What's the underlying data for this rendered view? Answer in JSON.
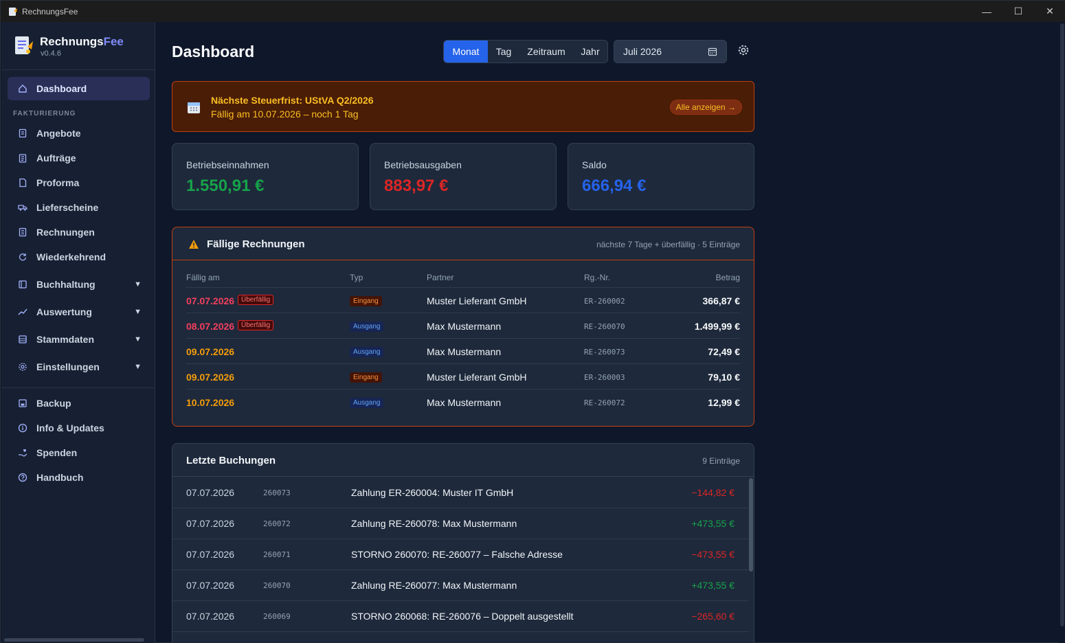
{
  "window": {
    "title": "RechnungsFee"
  },
  "brand": {
    "name_part1": "Rechnungs",
    "name_part2": "Fee",
    "version": "v0.4.6"
  },
  "sidebar": {
    "dashboard": "Dashboard",
    "section_fakturierung": "FAKTURIERUNG",
    "items": [
      {
        "label": "Angebote"
      },
      {
        "label": "Aufträge"
      },
      {
        "label": "Proforma"
      },
      {
        "label": "Lieferscheine"
      },
      {
        "label": "Rechnungen"
      },
      {
        "label": "Wiederkehrend"
      }
    ],
    "groups": [
      {
        "label": "Buchhaltung"
      },
      {
        "label": "Auswertung"
      },
      {
        "label": "Stammdaten"
      },
      {
        "label": "Einstellungen"
      }
    ],
    "footer": [
      {
        "label": "Backup"
      },
      {
        "label": "Info & Updates"
      },
      {
        "label": "Spenden"
      },
      {
        "label": "Handbuch"
      }
    ]
  },
  "header": {
    "title": "Dashboard",
    "periods": [
      "Monat",
      "Tag",
      "Zeitraum",
      "Jahr"
    ],
    "selected_period": "Monat",
    "month_value": "Juli 2026"
  },
  "alert": {
    "title": "Nächste Steuerfrist: UStVA Q2/2026",
    "subtitle": "Fällig am 10.07.2026 – noch 1 Tag",
    "button": "Alle anzeigen →"
  },
  "kpis": {
    "income_label": "Betriebseinnahmen",
    "income_value": "1.550,91 €",
    "expense_label": "Betriebsausgaben",
    "expense_value": "883,97 €",
    "balance_label": "Saldo",
    "balance_value": "666,94 €"
  },
  "due": {
    "title": "Fällige Rechnungen",
    "meta": "nächste 7 Tage + überfällig · 5 Einträge",
    "columns": {
      "date": "Fällig am",
      "type": "Typ",
      "partner": "Partner",
      "number": "Rg.-Nr.",
      "amount": "Betrag"
    },
    "overdue_label": "Überfällig",
    "rows": [
      {
        "date": "07.07.2026",
        "type": "Eingang",
        "partner": "Muster Lieferant GmbH",
        "number": "ER-260002",
        "amount": "366,87 €"
      },
      {
        "date": "08.07.2026",
        "type": "Ausgang",
        "partner": "Max Mustermann",
        "number": "RE-260070",
        "amount": "1.499,99 €"
      },
      {
        "date": "09.07.2026",
        "type": "Ausgang",
        "partner": "Max Mustermann",
        "number": "RE-260073",
        "amount": "72,49 €"
      },
      {
        "date": "09.07.2026",
        "type": "Eingang",
        "partner": "Muster Lieferant GmbH",
        "number": "ER-260003",
        "amount": "79,10 €"
      },
      {
        "date": "10.07.2026",
        "type": "Ausgang",
        "partner": "Max Mustermann",
        "number": "RE-260072",
        "amount": "12,99 €"
      }
    ]
  },
  "bookings": {
    "title": "Letzte Buchungen",
    "meta": "9 Einträge",
    "rows": [
      {
        "date": "07.07.2026",
        "number": "260073",
        "text": "Zahlung ER-260004: Muster IT GmbH",
        "amount": "−144,82 €"
      },
      {
        "date": "07.07.2026",
        "number": "260072",
        "text": "Zahlung RE-260078: Max Mustermann",
        "amount": "+473,55 €"
      },
      {
        "date": "07.07.2026",
        "number": "260071",
        "text": "STORNO 260070: RE-260077 – Falsche Adresse",
        "amount": "−473,55 €"
      },
      {
        "date": "07.07.2026",
        "number": "260070",
        "text": "Zahlung RE-260077: Max Mustermann",
        "amount": "+473,55 €"
      },
      {
        "date": "07.07.2026",
        "number": "260069",
        "text": "STORNO 260068: RE-260076 – Doppelt ausgestellt",
        "amount": "−265,60 €"
      }
    ]
  },
  "colors": {
    "accent": "#2563eb",
    "income": "#16a34a",
    "expense": "#dc2626",
    "warning": "#f59e0b"
  }
}
